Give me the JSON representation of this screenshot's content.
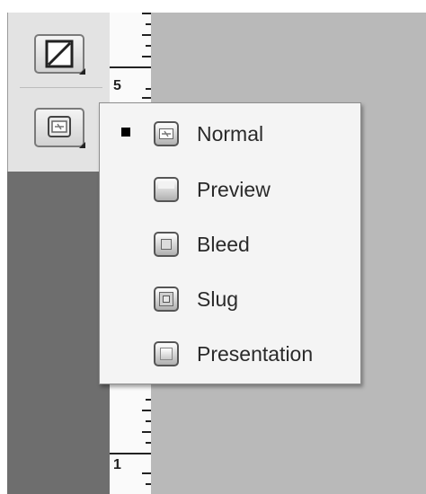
{
  "ruler": {
    "labels": [
      "5",
      "1"
    ]
  },
  "screen_mode_menu": {
    "selected": "Normal",
    "items": [
      {
        "label": "Normal",
        "icon": "normal-mode-icon",
        "checked": true
      },
      {
        "label": "Preview",
        "icon": "preview-mode-icon",
        "checked": false
      },
      {
        "label": "Bleed",
        "icon": "bleed-mode-icon",
        "checked": false
      },
      {
        "label": "Slug",
        "icon": "slug-mode-icon",
        "checked": false
      },
      {
        "label": "Presentation",
        "icon": "presentation-mode-icon",
        "checked": false
      }
    ]
  }
}
